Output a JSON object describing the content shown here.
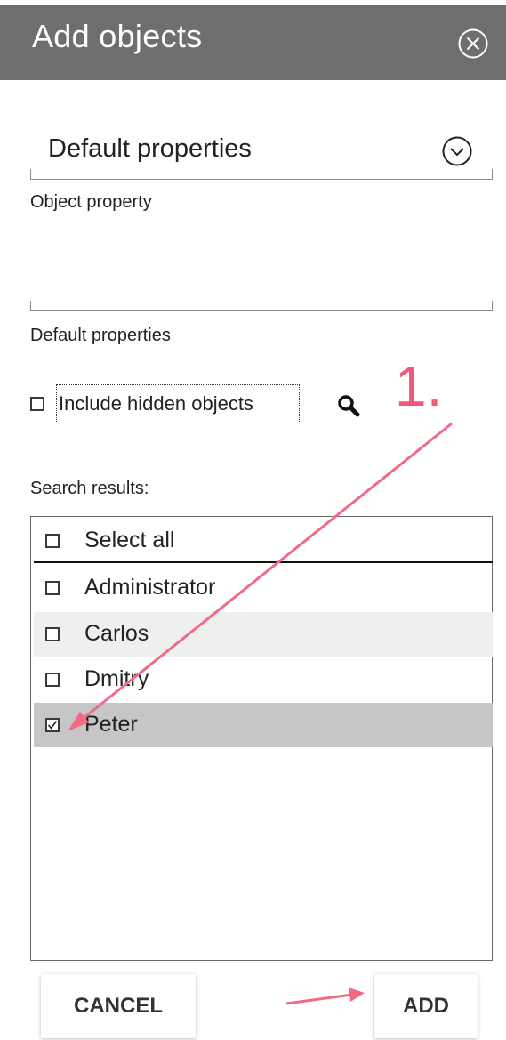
{
  "dialog": {
    "title": "Add objects",
    "close_icon": "close-circle-icon"
  },
  "property_dropdown": {
    "selected_value": "Default properties",
    "icon": "chevron-down-circle-icon",
    "label": "Object property"
  },
  "default_properties_field": {
    "value": "",
    "label": "Default properties"
  },
  "include_hidden": {
    "label": "Include hidden objects",
    "checked": false
  },
  "search_icon": "search-icon",
  "search_results": {
    "label": "Search results:",
    "select_all": {
      "label": "Select all",
      "checked": false
    },
    "items": [
      {
        "label": "Administrator",
        "checked": false
      },
      {
        "label": "Carlos",
        "checked": false
      },
      {
        "label": "Dmitry",
        "checked": false
      },
      {
        "label": "Peter",
        "checked": true
      }
    ]
  },
  "buttons": {
    "cancel": "CANCEL",
    "add": "ADD"
  },
  "annotation": {
    "step_label": "1.",
    "color": "#f0577a"
  },
  "colors": {
    "titlebar": "#6e6e6e",
    "selected_row": "#c6c6c6",
    "striped_row": "#efefef"
  }
}
